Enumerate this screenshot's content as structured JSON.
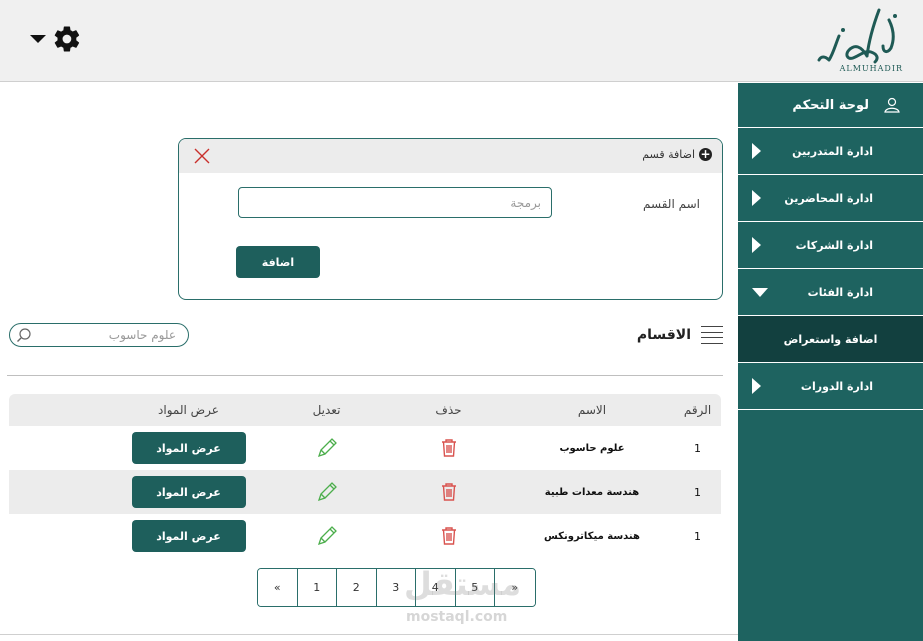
{
  "header": {
    "logo_text": "ALMUHADIR",
    "settings_icon": "gear-icon",
    "menu_icon": "caret-down-icon"
  },
  "sidebar": {
    "title": "لوحة التحكم",
    "title_icon": "user-icon",
    "items": [
      {
        "label": "ادارة المتدربين",
        "icon": "triangle-right-icon"
      },
      {
        "label": "ادارة المحاضرين",
        "icon": "triangle-right-icon"
      },
      {
        "label": "ادارة الشركات",
        "icon": "triangle-right-icon"
      },
      {
        "label": "ادارة الفئات",
        "icon": "triangle-down-icon"
      },
      {
        "label": "اضافة واستعراض",
        "active": true
      },
      {
        "label": "ادارة الدورات",
        "icon": "triangle-right-icon"
      }
    ],
    "bg_color": "#1e6360",
    "active_color": "#12403f"
  },
  "add_panel": {
    "title": "اضافة قسم",
    "field_label": "اسم القسم",
    "field_placeholder": "برمجة",
    "submit_label": "اضافة"
  },
  "list": {
    "title": "الاقسام",
    "search_placeholder": "علوم حاسوب",
    "columns": {
      "num": "الرقم",
      "name": "الاسم",
      "delete": "حذف",
      "edit": "تعديل",
      "view": "عرض المواد"
    },
    "rows": [
      {
        "num": "1",
        "name": "علوم حاسوب",
        "view_label": "عرض المواد"
      },
      {
        "num": "1",
        "name": "هندسة معدات طبية",
        "view_label": "عرض المواد"
      },
      {
        "num": "1",
        "name": "هندسة ميكاترونكس",
        "view_label": "عرض المواد"
      }
    ]
  },
  "pagination": {
    "pages": [
      "«",
      "1",
      "2",
      "3",
      "4",
      "5",
      "»"
    ]
  },
  "watermark": {
    "ar": "مستقل",
    "en": "mostaql.com"
  },
  "colors": {
    "accent": "#1e5f5c",
    "delete": "#d9534f",
    "edit": "#4cae4c"
  }
}
